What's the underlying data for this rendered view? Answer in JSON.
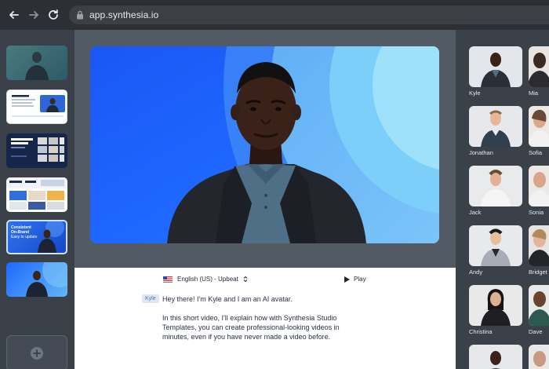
{
  "browser": {
    "url": "app.synthesia.io"
  },
  "left_rail": {
    "scenes": [
      {
        "name": "scene-1",
        "selected": false
      },
      {
        "name": "scene-2",
        "selected": false
      },
      {
        "name": "scene-3",
        "selected": false
      },
      {
        "name": "scene-4",
        "selected": false
      },
      {
        "name": "scene-5",
        "selected": false
      },
      {
        "name": "scene-6",
        "selected": true
      }
    ],
    "scene_texts": {
      "s5_line1": "Consistent",
      "s5_line2": "On-Brand",
      "s5_line3": "Easy to update"
    }
  },
  "editor": {
    "voice_label": "English (US) - Upbeat",
    "play_label": "Play",
    "speaker_tag": "Kyle",
    "script_line_1": "Hey there! I'm Kyle and I am an AI avatar.",
    "script_line_2": "In this short video, I'll explain how with Synthesia Studio Templates, you can create professional-looking videos in minutes, even if you have never made a video before."
  },
  "avatars": [
    {
      "name": "Kyle"
    },
    {
      "name": "Mia"
    },
    {
      "name": "Jonathan"
    },
    {
      "name": "Sofia"
    },
    {
      "name": "Jack"
    },
    {
      "name": "Sonia"
    },
    {
      "name": "Andy"
    },
    {
      "name": "Bridget"
    },
    {
      "name": "Christina"
    },
    {
      "name": "Dave"
    },
    {
      "name": ""
    },
    {
      "name": ""
    }
  ],
  "colors": {
    "accent_blue": "#1f68ff",
    "panel_dark": "#3a4048",
    "white": "#ffffff"
  }
}
